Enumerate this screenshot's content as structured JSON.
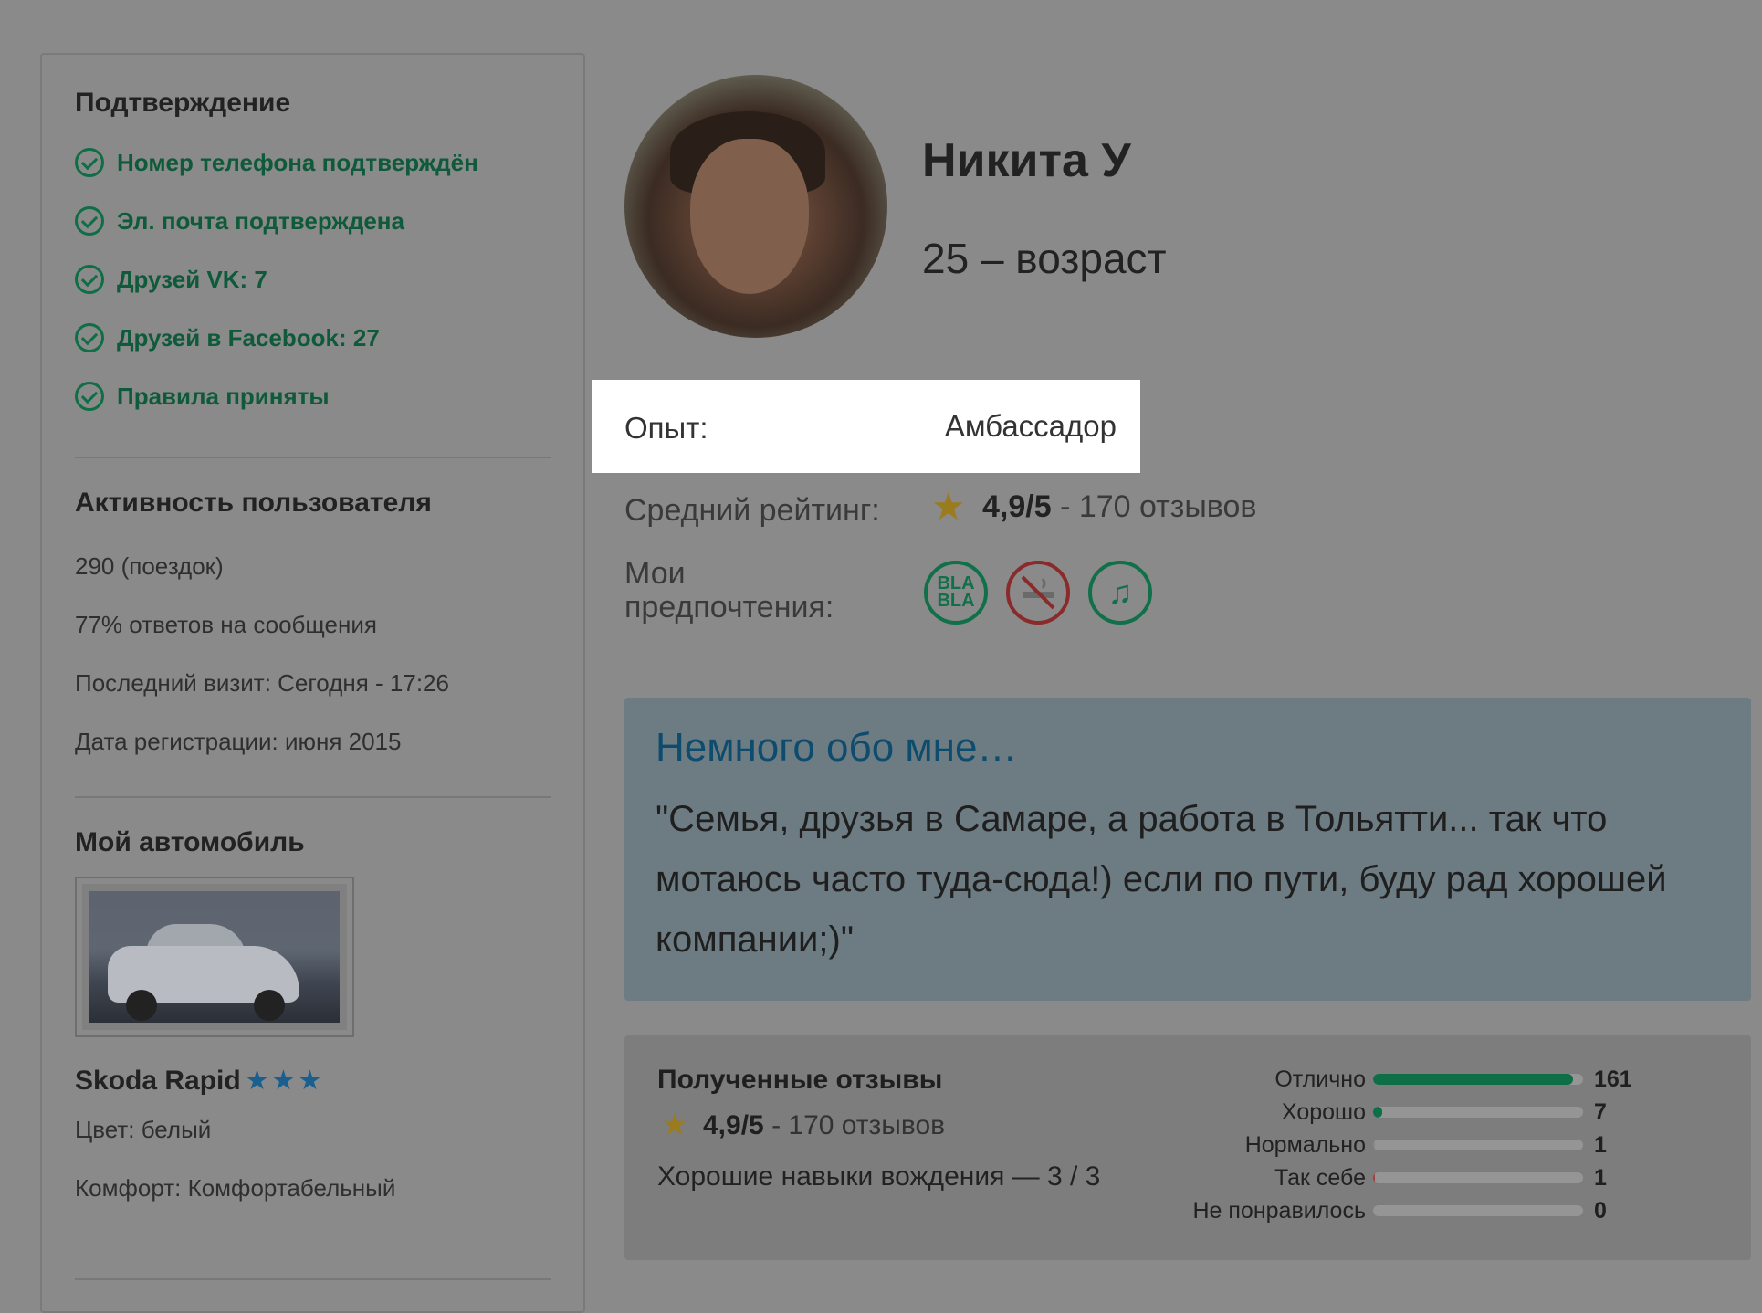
{
  "verification": {
    "title": "Подтверждение",
    "items": [
      {
        "label": "Номер телефона подтверждён"
      },
      {
        "label": "Эл. почта подтверждена"
      },
      {
        "label": "Друзей VK: 7"
      },
      {
        "label": "Друзей в Facebook: 27"
      },
      {
        "label": "Правила приняты"
      }
    ]
  },
  "activity": {
    "title": "Активность пользователя",
    "trips": "290 (поездок)",
    "response_rate": "77% ответов на сообщения",
    "last_visit": "Последний визит: Сегодня - 17:26",
    "registered": "Дата регистрации: июня 2015"
  },
  "car": {
    "title": "Мой автомобиль",
    "name": "Skoda Rapid",
    "stars": "★★★",
    "color": "Цвет: белый",
    "comfort": "Комфорт: Комфортабельный"
  },
  "profile": {
    "name": "Никита У",
    "age": "25 – возраст",
    "experience_label": "Опыт:",
    "experience_value": "Амбассадор",
    "rating_label": "Средний рейтинг:",
    "rating_score": "4,9/5",
    "rating_count": " - 170 отзывов",
    "prefs_label_line1": "Мои",
    "prefs_label_line2": "предпочтения:",
    "prefs": [
      {
        "icon": "blabla-icon",
        "text": "BLA BLA"
      },
      {
        "icon": "no-smoking-icon"
      },
      {
        "icon": "music-icon",
        "glyph": "♫"
      }
    ]
  },
  "about": {
    "title": "Немного обо мне…",
    "text": "\"Семья, друзья в Самаре, а работа в Тольятти... так что мотаюсь часто туда-сюда!) если по пути, буду рад хорошей компании;)\""
  },
  "reviews": {
    "title": "Полученные отзывы",
    "score": "4,9/5",
    "count": " - 170 отзывов",
    "skill": "Хорошие навыки вождения — 3 / 3",
    "breakdown": [
      {
        "label": "Отлично",
        "count": "161",
        "fraction": 0.95,
        "color": "#0e6e45"
      },
      {
        "label": "Хорошо",
        "count": "7",
        "fraction": 0.045,
        "color": "#0e6e45"
      },
      {
        "label": "Нормально",
        "count": "1",
        "fraction": 0.01,
        "color": "#888888"
      },
      {
        "label": "Так себе",
        "count": "1",
        "fraction": 0.01,
        "color": "#a04040"
      },
      {
        "label": "Не понравилось",
        "count": "0",
        "fraction": 0.0,
        "color": "#888888"
      }
    ]
  }
}
